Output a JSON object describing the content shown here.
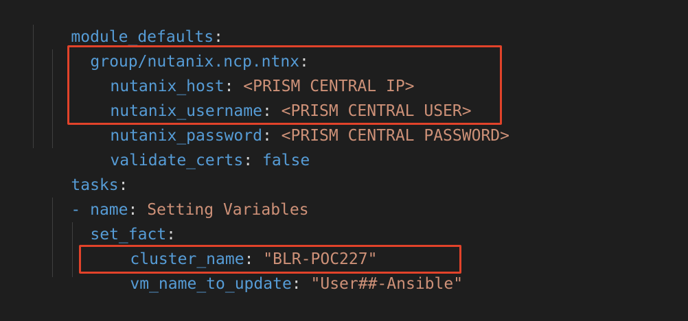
{
  "code": {
    "lines": [
      {
        "key": "module_defaults",
        "sep": ":",
        "value": ""
      },
      {
        "key": "group/nutanix.ncp.ntnx",
        "sep": ":",
        "value": ""
      },
      {
        "key": "nutanix_host",
        "sep": ": ",
        "value": "<PRISM CENTRAL IP>"
      },
      {
        "key": "nutanix_username",
        "sep": ": ",
        "value": "<PRISM CENTRAL USER>"
      },
      {
        "key": "nutanix_password",
        "sep": ": ",
        "value": "<PRISM CENTRAL PASSWORD>"
      },
      {
        "key": "validate_certs",
        "sep": ": ",
        "value": "false"
      },
      {
        "key": "tasks",
        "sep": ":",
        "value": ""
      },
      {
        "dash": "- ",
        "key": "name",
        "sep": ": ",
        "value": "Setting Variables"
      },
      {
        "key": "set_fact",
        "sep": ":",
        "value": ""
      },
      {
        "key": "cluster_name",
        "sep": ": ",
        "value": "\"BLR-POC227\""
      },
      {
        "key": "vm_name_to_update",
        "sep": ": ",
        "value": "\"User##-Ansible\""
      }
    ]
  },
  "colors": {
    "background": "#1e1e1e",
    "key": "#569cd6",
    "string": "#ce9178",
    "punctuation": "#d4d4d4",
    "highlight_box": "#e2432a"
  }
}
